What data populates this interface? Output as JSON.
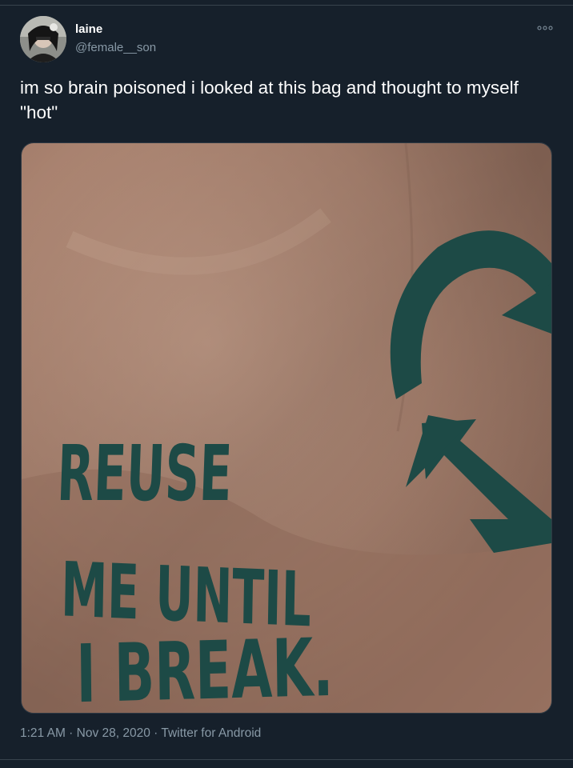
{
  "tweet": {
    "display_name": "laine",
    "handle": "@female__son",
    "text": "im so brain poisoned i looked at this bag and thought to myself \"hot\"",
    "timestamp": "1:21 AM · Nov 28, 2020 · Twitter for Android",
    "more_icon": "more-horizontal-icon",
    "avatar_icon": "avatar"
  },
  "photo": {
    "bag_text_line1": "REUSE",
    "bag_text_line2": "ME UNTIL",
    "bag_text_line3": "I BREAK.",
    "bag_color": "#b08773",
    "ink_color": "#1d4a46",
    "recycle_icon": "recycle-arrows-icon"
  },
  "colors": {
    "background": "#16202b",
    "text_primary": "#ffffff",
    "text_secondary": "#8899a6",
    "divider": "#38444d"
  }
}
